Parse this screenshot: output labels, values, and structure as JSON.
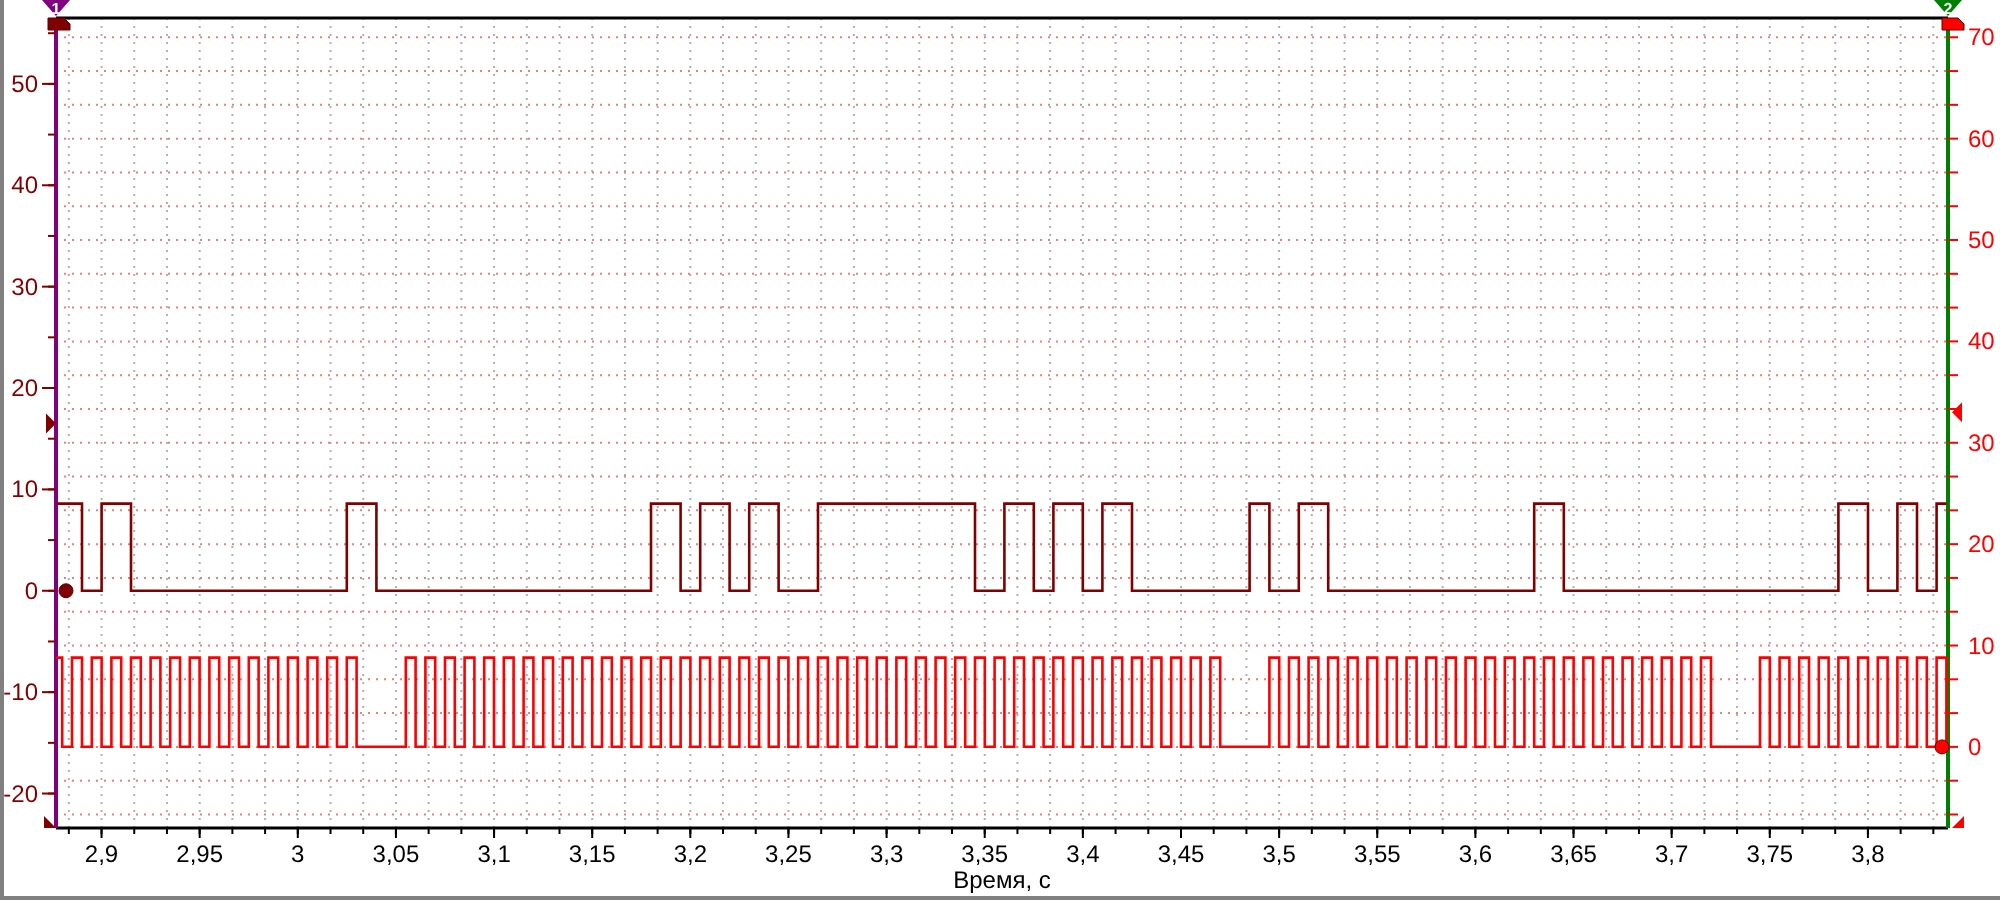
{
  "cursors": [
    {
      "label": "1",
      "color": "#800080"
    },
    {
      "label": "2",
      "color": "#008000"
    }
  ],
  "chart_data": {
    "type": "line",
    "grid": true,
    "xlabel": "Время, с",
    "xlim": [
      2.8768,
      3.8408
    ],
    "ylim": [
      -23.4,
      56.5
    ],
    "y2lim": [
      -8,
      71.9
    ],
    "xticks": [
      {
        "value": 2.9,
        "label": "2,9"
      },
      {
        "value": 2.95,
        "label": "2,95"
      },
      {
        "value": 3,
        "label": "3"
      },
      {
        "value": 3.05,
        "label": "3,05"
      },
      {
        "value": 3.1,
        "label": "3,1"
      },
      {
        "value": 3.15,
        "label": "3,15"
      },
      {
        "value": 3.2,
        "label": "3,2"
      },
      {
        "value": 3.25,
        "label": "3,25"
      },
      {
        "value": 3.3,
        "label": "3,3"
      },
      {
        "value": 3.35,
        "label": "3,35"
      },
      {
        "value": 3.4,
        "label": "3,4"
      },
      {
        "value": 3.45,
        "label": "3,45"
      },
      {
        "value": 3.5,
        "label": "3,5"
      },
      {
        "value": 3.55,
        "label": "3,55"
      },
      {
        "value": 3.6,
        "label": "3,6"
      },
      {
        "value": 3.65,
        "label": "3,65"
      },
      {
        "value": 3.7,
        "label": "3,7"
      },
      {
        "value": 3.75,
        "label": "3,75"
      },
      {
        "value": 3.8,
        "label": "3,8"
      }
    ],
    "yticks": [
      -20,
      -10,
      0,
      10,
      20,
      30,
      40,
      50
    ],
    "y2ticks": [
      0,
      10,
      20,
      30,
      40,
      50,
      60,
      70
    ],
    "x": [
      2.877,
      2.88,
      2.88,
      2.885,
      2.885,
      2.89,
      2.89,
      2.895,
      2.895,
      2.9,
      2.9,
      2.905,
      2.905,
      2.91,
      2.91,
      2.915,
      2.915,
      2.92,
      2.92,
      2.925,
      2.925,
      2.93,
      2.93,
      2.935,
      2.935,
      2.94,
      2.94,
      2.945,
      2.945,
      2.95,
      2.95,
      2.955,
      2.955,
      2.96,
      2.96,
      2.965,
      2.965,
      2.97,
      2.97,
      2.975,
      2.975,
      2.98,
      2.98,
      2.985,
      2.985,
      2.99,
      2.99,
      2.995,
      2.995,
      3,
      3,
      3.005,
      3.005,
      3.01,
      3.01,
      3.015,
      3.015,
      3.02,
      3.02,
      3.025,
      3.025,
      3.03,
      3.03,
      3.035,
      3.035,
      3.04,
      3.04,
      3.045,
      3.045,
      3.05,
      3.05,
      3.055,
      3.055,
      3.06,
      3.06,
      3.065,
      3.065,
      3.07,
      3.07,
      3.075,
      3.075,
      3.08,
      3.08,
      3.085,
      3.085,
      3.09,
      3.09,
      3.095,
      3.095,
      3.1,
      3.1,
      3.105,
      3.105,
      3.11,
      3.11,
      3.115,
      3.115,
      3.12,
      3.12,
      3.125,
      3.125,
      3.13,
      3.13,
      3.135,
      3.135,
      3.14,
      3.14,
      3.145,
      3.145,
      3.15,
      3.15,
      3.155,
      3.155,
      3.16,
      3.16,
      3.165,
      3.165,
      3.17,
      3.17,
      3.175,
      3.175,
      3.18,
      3.18,
      3.185,
      3.185,
      3.19,
      3.19,
      3.195,
      3.195,
      3.2,
      3.2,
      3.205,
      3.205,
      3.21,
      3.21,
      3.215,
      3.215,
      3.22,
      3.22,
      3.225,
      3.225,
      3.23,
      3.23,
      3.235,
      3.235,
      3.24,
      3.24,
      3.245,
      3.245,
      3.25,
      3.25,
      3.255,
      3.255,
      3.26,
      3.26,
      3.265,
      3.265,
      3.27,
      3.27,
      3.275,
      3.275,
      3.28,
      3.28,
      3.285,
      3.285,
      3.29,
      3.29,
      3.295,
      3.295,
      3.3,
      3.3,
      3.305,
      3.305,
      3.31,
      3.31,
      3.315,
      3.315,
      3.32,
      3.32,
      3.325,
      3.325,
      3.33,
      3.33,
      3.335,
      3.335,
      3.34,
      3.34,
      3.345,
      3.345,
      3.35,
      3.35,
      3.355,
      3.355,
      3.36,
      3.36,
      3.365,
      3.365,
      3.37,
      3.37,
      3.375,
      3.375,
      3.38,
      3.38,
      3.385,
      3.385,
      3.39,
      3.39,
      3.395,
      3.395,
      3.4,
      3.4,
      3.405,
      3.405,
      3.41,
      3.41,
      3.415,
      3.415,
      3.42,
      3.42,
      3.425,
      3.425,
      3.43,
      3.43,
      3.435,
      3.435,
      3.44,
      3.44,
      3.445,
      3.445,
      3.45,
      3.45,
      3.455,
      3.455,
      3.46,
      3.46,
      3.465,
      3.465,
      3.47,
      3.47,
      3.475,
      3.475,
      3.48,
      3.48,
      3.485,
      3.485,
      3.49,
      3.49,
      3.495,
      3.495,
      3.5,
      3.5,
      3.505,
      3.505,
      3.51,
      3.51,
      3.515,
      3.515,
      3.52,
      3.52,
      3.525,
      3.525,
      3.53,
      3.53,
      3.535,
      3.535,
      3.54,
      3.54,
      3.545,
      3.545,
      3.55,
      3.55,
      3.555,
      3.555,
      3.56,
      3.56,
      3.565,
      3.565,
      3.57,
      3.57,
      3.575,
      3.575,
      3.58,
      3.58,
      3.585,
      3.585,
      3.59,
      3.59,
      3.595,
      3.595,
      3.6,
      3.6,
      3.605,
      3.605,
      3.61,
      3.61,
      3.615,
      3.615,
      3.62,
      3.62,
      3.625,
      3.625,
      3.63,
      3.63,
      3.635,
      3.635,
      3.64,
      3.64,
      3.645,
      3.645,
      3.65,
      3.65,
      3.655,
      3.655,
      3.66,
      3.66,
      3.665,
      3.665,
      3.67,
      3.67,
      3.675,
      3.675,
      3.68,
      3.68,
      3.685,
      3.685,
      3.69,
      3.69,
      3.695,
      3.695,
      3.7,
      3.7,
      3.705,
      3.705,
      3.71,
      3.71,
      3.715,
      3.715,
      3.72,
      3.72,
      3.725,
      3.725,
      3.73,
      3.73,
      3.735,
      3.735,
      3.74,
      3.74,
      3.745,
      3.745,
      3.75,
      3.75,
      3.755,
      3.755,
      3.76,
      3.76,
      3.765,
      3.765,
      3.77,
      3.77,
      3.775,
      3.775,
      3.78,
      3.78,
      3.785,
      3.785,
      3.79,
      3.79,
      3.795,
      3.795,
      3.8,
      3.8,
      3.805,
      3.805,
      3.81,
      3.81,
      3.815,
      3.815,
      3.82,
      3.82,
      3.825,
      3.825,
      3.83,
      3.83,
      3.835,
      3.835,
      3.84,
      3.84
    ],
    "series": [
      {
        "color": "#800000",
        "values": [
          8.6,
          8.6,
          8.6,
          8.6,
          8.6,
          8.6,
          0,
          0,
          0,
          0,
          8.6,
          8.6,
          8.6,
          8.6,
          8.6,
          8.6,
          0,
          0,
          0,
          0,
          0,
          0,
          0,
          0,
          0,
          0,
          0,
          0,
          0,
          0,
          0,
          0,
          0,
          0,
          0,
          0,
          0,
          0,
          0,
          0,
          0,
          0,
          0,
          0,
          0,
          0,
          0,
          0,
          0,
          0,
          0,
          0,
          0,
          0,
          0,
          0,
          0,
          0,
          0,
          0,
          8.6,
          8.6,
          8.6,
          8.6,
          8.6,
          8.6,
          0,
          0,
          0,
          0,
          0,
          0,
          0,
          0,
          0,
          0,
          0,
          0,
          0,
          0,
          0,
          0,
          0,
          0,
          0,
          0,
          0,
          0,
          0,
          0,
          0,
          0,
          0,
          0,
          0,
          0,
          0,
          0,
          0,
          0,
          0,
          0,
          0,
          0,
          0,
          0,
          0,
          0,
          0,
          0,
          0,
          0,
          0,
          0,
          0,
          0,
          0,
          0,
          0,
          0,
          0,
          0,
          8.6,
          8.6,
          8.6,
          8.6,
          8.6,
          8.6,
          0,
          0,
          0,
          0,
          8.6,
          8.6,
          8.6,
          8.6,
          8.6,
          8.6,
          0,
          0,
          0,
          0,
          8.6,
          8.6,
          8.6,
          8.6,
          8.6,
          8.6,
          0,
          0,
          0,
          0,
          0,
          0,
          0,
          0,
          8.6,
          8.6,
          8.6,
          8.6,
          8.6,
          8.6,
          8.6,
          8.6,
          8.6,
          8.6,
          8.6,
          8.6,
          8.6,
          8.6,
          8.6,
          8.6,
          8.6,
          8.6,
          8.6,
          8.6,
          8.6,
          8.6,
          8.6,
          8.6,
          8.6,
          8.6,
          8.6,
          8.6,
          8.6,
          8.6,
          8.6,
          8.6,
          0,
          0,
          0,
          0,
          0,
          0,
          8.6,
          8.6,
          8.6,
          8.6,
          8.6,
          8.6,
          0,
          0,
          0,
          0,
          8.6,
          8.6,
          8.6,
          8.6,
          8.6,
          8.6,
          0,
          0,
          0,
          0,
          8.6,
          8.6,
          8.6,
          8.6,
          8.6,
          8.6,
          0,
          0,
          0,
          0,
          0,
          0,
          0,
          0,
          0,
          0,
          0,
          0,
          0,
          0,
          0,
          0,
          0,
          0,
          0,
          0,
          0,
          0,
          0,
          0,
          8.6,
          8.6,
          8.6,
          8.6,
          0,
          0,
          0,
          0,
          0,
          0,
          8.6,
          8.6,
          8.6,
          8.6,
          8.6,
          8.6,
          0,
          0,
          0,
          0,
          0,
          0,
          0,
          0,
          0,
          0,
          0,
          0,
          0,
          0,
          0,
          0,
          0,
          0,
          0,
          0,
          0,
          0,
          0,
          0,
          0,
          0,
          0,
          0,
          0,
          0,
          0,
          0,
          0,
          0,
          0,
          0,
          0,
          0,
          0,
          0,
          0,
          0,
          8.6,
          8.6,
          8.6,
          8.6,
          8.6,
          8.6,
          0,
          0,
          0,
          0,
          0,
          0,
          0,
          0,
          0,
          0,
          0,
          0,
          0,
          0,
          0,
          0,
          0,
          0,
          0,
          0,
          0,
          0,
          0,
          0,
          0,
          0,
          0,
          0,
          0,
          0,
          0,
          0,
          0,
          0,
          0,
          0,
          0,
          0,
          0,
          0,
          0,
          0,
          0,
          0,
          0,
          0,
          0,
          0,
          0,
          0,
          0,
          0,
          0,
          0,
          0,
          0,
          8.6,
          8.6,
          8.6,
          8.6,
          8.6,
          8.6,
          0,
          0,
          0,
          0,
          0,
          0,
          8.6,
          8.6,
          8.6,
          8.6,
          0,
          0,
          0,
          0,
          8.6,
          8.6,
          8.6
        ]
      },
      {
        "color": "#ff0000",
        "axis": "y2",
        "values": [
          8.8,
          8.8,
          0,
          0,
          8.8,
          8.8,
          0,
          0,
          8.8,
          8.8,
          0,
          0,
          8.8,
          8.8,
          0,
          0,
          8.8,
          8.8,
          0,
          0,
          8.8,
          8.8,
          0,
          0,
          8.8,
          8.8,
          0,
          0,
          8.8,
          8.8,
          0,
          0,
          8.8,
          8.8,
          0,
          0,
          8.8,
          8.8,
          0,
          0,
          8.8,
          8.8,
          0,
          0,
          8.8,
          8.8,
          0,
          0,
          8.8,
          8.8,
          0,
          0,
          8.8,
          8.8,
          0,
          0,
          8.8,
          8.8,
          0,
          0,
          8.8,
          8.8,
          0,
          0,
          0,
          0,
          0,
          0,
          0,
          0,
          0,
          0,
          8.8,
          8.8,
          0,
          0,
          8.8,
          8.8,
          0,
          0,
          8.8,
          8.8,
          0,
          0,
          8.8,
          8.8,
          0,
          0,
          8.8,
          8.8,
          0,
          0,
          8.8,
          8.8,
          0,
          0,
          8.8,
          8.8,
          0,
          0,
          8.8,
          8.8,
          0,
          0,
          8.8,
          8.8,
          0,
          0,
          8.8,
          8.8,
          0,
          0,
          8.8,
          8.8,
          0,
          0,
          8.8,
          8.8,
          0,
          0,
          8.8,
          8.8,
          0,
          0,
          8.8,
          8.8,
          0,
          0,
          8.8,
          8.8,
          0,
          0,
          8.8,
          8.8,
          0,
          0,
          8.8,
          8.8,
          0,
          0,
          8.8,
          8.8,
          0,
          0,
          8.8,
          8.8,
          0,
          0,
          8.8,
          8.8,
          0,
          0,
          8.8,
          8.8,
          0,
          0,
          8.8,
          8.8,
          0,
          0,
          8.8,
          8.8,
          0,
          0,
          8.8,
          8.8,
          0,
          0,
          8.8,
          8.8,
          0,
          0,
          8.8,
          8.8,
          0,
          0,
          8.8,
          8.8,
          0,
          0,
          8.8,
          8.8,
          0,
          0,
          8.8,
          8.8,
          0,
          0,
          8.8,
          8.8,
          0,
          0,
          8.8,
          8.8,
          0,
          0,
          8.8,
          8.8,
          0,
          0,
          8.8,
          8.8,
          0,
          0,
          8.8,
          8.8,
          0,
          0,
          8.8,
          8.8,
          0,
          0,
          8.8,
          8.8,
          0,
          0,
          8.8,
          8.8,
          0,
          0,
          8.8,
          8.8,
          0,
          0,
          8.8,
          8.8,
          0,
          0,
          8.8,
          8.8,
          0,
          0,
          8.8,
          8.8,
          0,
          0,
          8.8,
          8.8,
          0,
          0,
          0,
          0,
          0,
          0,
          0,
          0,
          0,
          0,
          8.8,
          8.8,
          0,
          0,
          8.8,
          8.8,
          0,
          0,
          8.8,
          8.8,
          0,
          0,
          8.8,
          8.8,
          0,
          0,
          8.8,
          8.8,
          0,
          0,
          8.8,
          8.8,
          0,
          0,
          8.8,
          8.8,
          0,
          0,
          8.8,
          8.8,
          0,
          0,
          8.8,
          8.8,
          0,
          0,
          8.8,
          8.8,
          0,
          0,
          8.8,
          8.8,
          0,
          0,
          8.8,
          8.8,
          0,
          0,
          8.8,
          8.8,
          0,
          0,
          8.8,
          8.8,
          0,
          0,
          8.8,
          8.8,
          0,
          0,
          8.8,
          8.8,
          0,
          0,
          8.8,
          8.8,
          0,
          0,
          8.8,
          8.8,
          0,
          0,
          8.8,
          8.8,
          0,
          0,
          8.8,
          8.8,
          0,
          0,
          8.8,
          8.8,
          0,
          0,
          8.8,
          8.8,
          0,
          0,
          8.8,
          8.8,
          0,
          0,
          0,
          0,
          0,
          0,
          0,
          0,
          0,
          0,
          8.8,
          8.8,
          0,
          0,
          8.8,
          8.8,
          0,
          0,
          8.8,
          8.8,
          0,
          0,
          8.8,
          8.8,
          0,
          0,
          8.8,
          8.8,
          0,
          0,
          8.8,
          8.8,
          0,
          0,
          8.8,
          8.8,
          0,
          0,
          8.8,
          8.8,
          0,
          0,
          8.8,
          8.8,
          0,
          0,
          8.8,
          8.8,
          0
        ]
      }
    ]
  }
}
